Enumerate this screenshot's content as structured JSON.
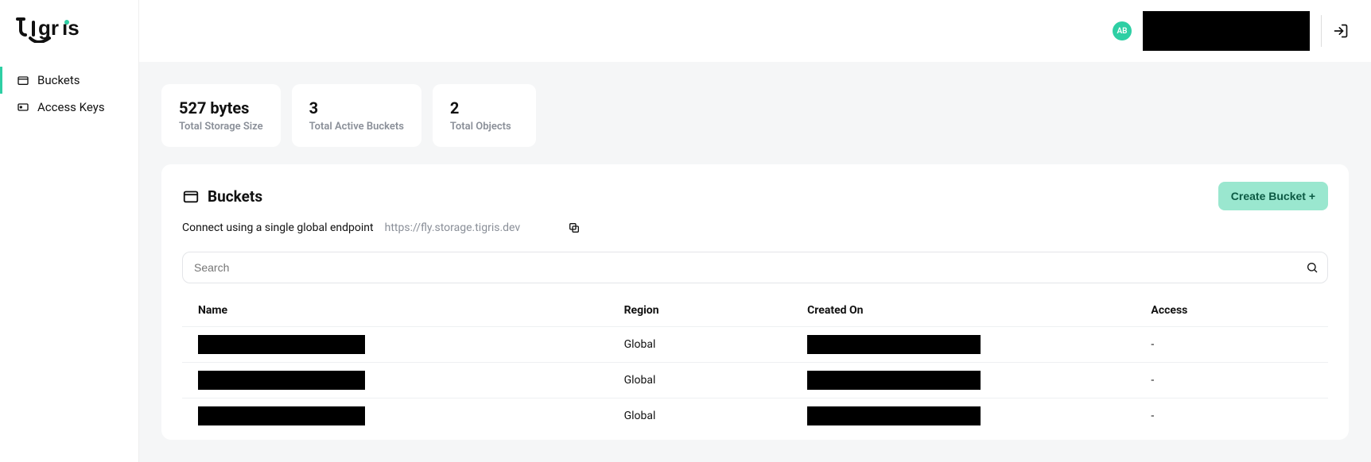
{
  "brand": "tigris",
  "sidebar": {
    "items": [
      {
        "label": "Buckets",
        "icon": "bucket-icon",
        "active": true
      },
      {
        "label": "Access Keys",
        "icon": "key-icon",
        "active": false
      }
    ]
  },
  "topbar": {
    "avatar_initials": "AB"
  },
  "stats": [
    {
      "value": "527 bytes",
      "label": "Total Storage Size"
    },
    {
      "value": "3",
      "label": "Total Active Buckets"
    },
    {
      "value": "2",
      "label": "Total Objects"
    }
  ],
  "buckets_panel": {
    "title": "Buckets",
    "create_label": "Create Bucket +",
    "endpoint_label": "Connect using a single global endpoint",
    "endpoint_url": "https://fly.storage.tigris.dev",
    "search_placeholder": "Search",
    "columns": {
      "name": "Name",
      "region": "Region",
      "created": "Created On",
      "access": "Access"
    },
    "rows": [
      {
        "region": "Global",
        "access": "-"
      },
      {
        "region": "Global",
        "access": "-"
      },
      {
        "region": "Global",
        "access": "-"
      }
    ]
  }
}
